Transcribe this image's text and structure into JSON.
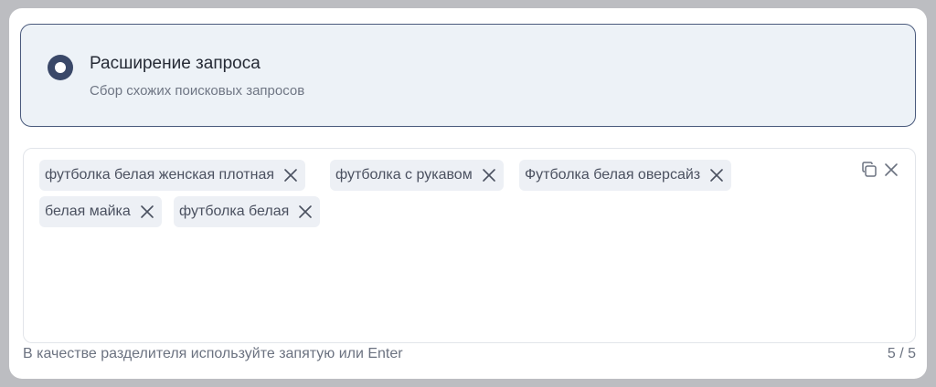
{
  "option": {
    "title": "Расширение запроса",
    "subtitle": "Сбор схожих поисковых запросов",
    "selected": true
  },
  "tags": [
    {
      "label": "футболка белая женская плотная"
    },
    {
      "label": "футболка с рукавом"
    },
    {
      "label": "Футболка белая оверсайз"
    },
    {
      "label": "белая майка"
    },
    {
      "label": "футболка белая"
    }
  ],
  "icons": {
    "tag_remove": "close-icon",
    "copy": "copy-icon",
    "clear": "close-icon",
    "radio": "radio-selected-icon"
  },
  "footer": {
    "hint": "В качестве разделителя используйте запятую или Enter",
    "counter": "5 / 5"
  },
  "colors": {
    "card_border": "#4a5a7c",
    "card_bg": "#edf2f7",
    "tag_bg": "#edf0f5",
    "radio": "#3a4868"
  }
}
